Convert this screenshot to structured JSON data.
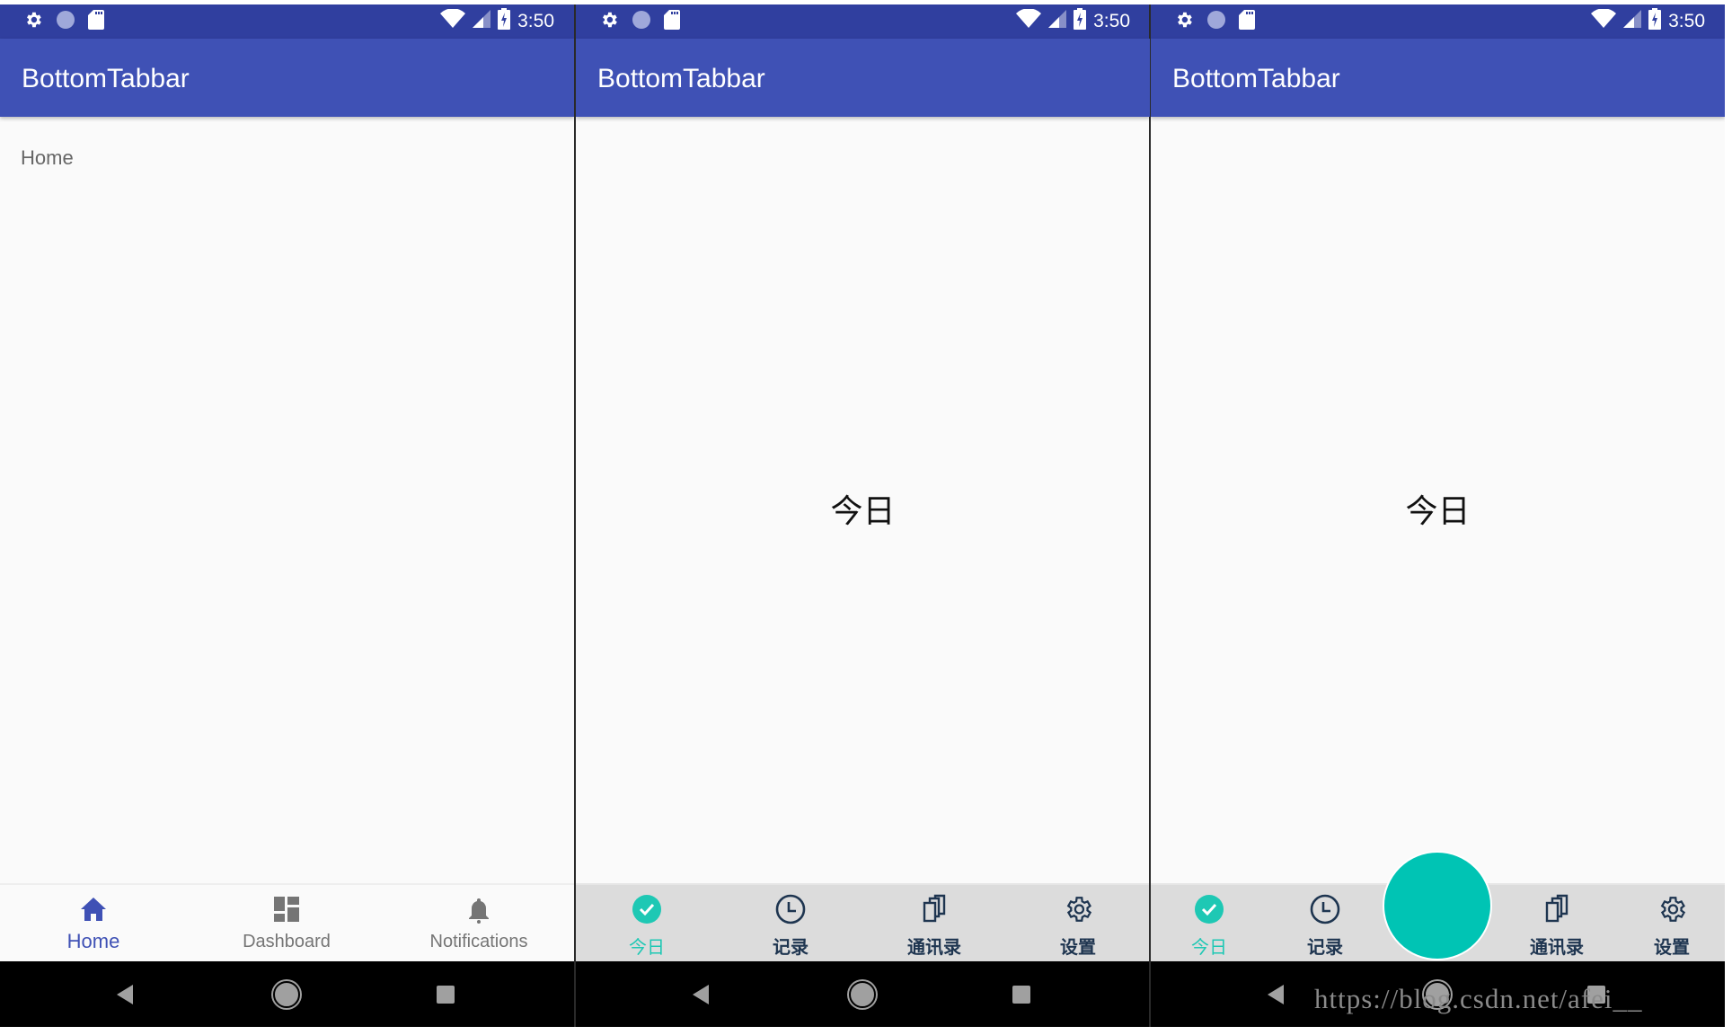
{
  "colors": {
    "status_bar": "#303f9f",
    "app_bar": "#3f51b5",
    "material_active": "#3f51b5",
    "material_inactive": "#757575",
    "tab_active": "#1ec8b4",
    "tab_inactive": "#1e3550",
    "tab_bar_bg": "#dcdcdc",
    "fab": "#00c4b4",
    "nav_bar": "#000000"
  },
  "status_bar": {
    "left_icons": [
      "settings-gear-icon",
      "circle-notification-icon",
      "sd-card-icon"
    ],
    "right_icons": [
      "wifi-icon",
      "cell-signal-icon",
      "battery-charging-icon"
    ],
    "time": "3:50"
  },
  "screens": [
    {
      "app_title": "BottomTabbar",
      "content_text": "Home",
      "bottom_nav": [
        {
          "label": "Home",
          "icon": "home-icon",
          "active": true
        },
        {
          "label": "Dashboard",
          "icon": "dashboard-icon",
          "active": false
        },
        {
          "label": "Notifications",
          "icon": "bell-icon",
          "active": false
        }
      ]
    },
    {
      "app_title": "BottomTabbar",
      "content_text": "今日",
      "tabs": [
        {
          "label": "今日",
          "icon": "check-circle-icon",
          "active": true
        },
        {
          "label": "记录",
          "icon": "clock-icon",
          "active": false
        },
        {
          "label": "通讯录",
          "icon": "contacts-copy-icon",
          "active": false
        },
        {
          "label": "设置",
          "icon": "settings-gear-icon",
          "active": false
        }
      ]
    },
    {
      "app_title": "BottomTabbar",
      "content_text": "今日",
      "tabs": [
        {
          "label": "今日",
          "icon": "check-circle-icon",
          "active": true
        },
        {
          "label": "记录",
          "icon": "clock-icon",
          "active": false
        },
        {
          "label": "通讯录",
          "icon": "contacts-copy-icon",
          "active": false
        },
        {
          "label": "设置",
          "icon": "settings-gear-icon",
          "active": false
        }
      ],
      "center_button": {
        "icon": "fab-circle"
      }
    }
  ],
  "nav_bar": {
    "buttons": [
      "back",
      "home",
      "recents"
    ]
  },
  "watermark": "https://blog.csdn.net/afei__"
}
